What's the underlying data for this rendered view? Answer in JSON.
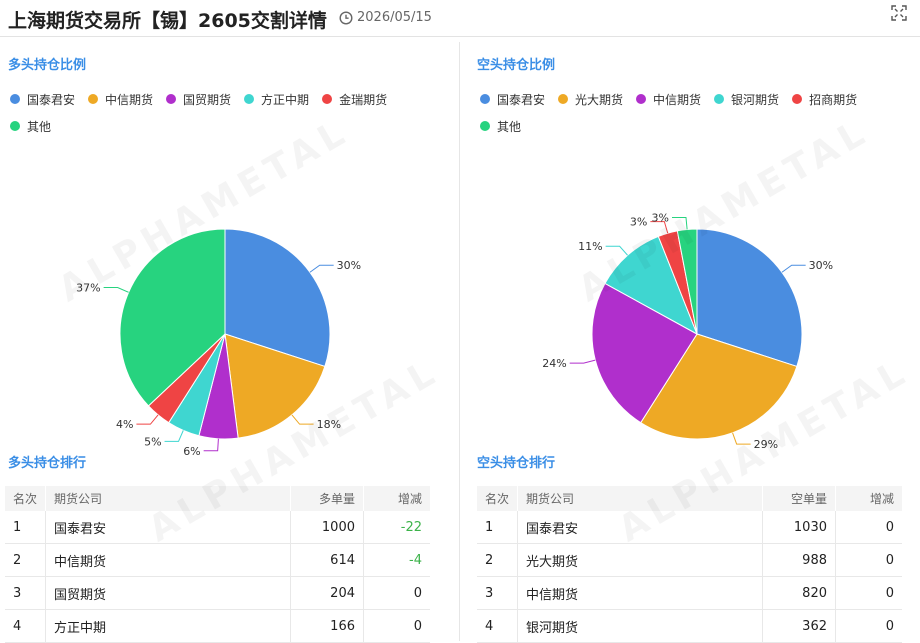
{
  "header": {
    "title": "上海期货交易所【锡】2605交割详情",
    "date": "2026/05/15"
  },
  "watermark": "ALPHAMETAL",
  "long_section": {
    "pie_title": "多头持仓比例",
    "table_title": "多头持仓排行",
    "columns": [
      "名次",
      "期货公司",
      "多单量",
      "增减"
    ],
    "rows": [
      {
        "rank": "1",
        "company": "国泰君安",
        "volume": "1000",
        "change": "-22"
      },
      {
        "rank": "2",
        "company": "中信期货",
        "volume": "614",
        "change": "-4"
      },
      {
        "rank": "3",
        "company": "国贸期货",
        "volume": "204",
        "change": "0"
      },
      {
        "rank": "4",
        "company": "方正中期",
        "volume": "166",
        "change": "0"
      }
    ]
  },
  "short_section": {
    "pie_title": "空头持仓比例",
    "table_title": "空头持仓排行",
    "columns": [
      "名次",
      "期货公司",
      "空单量",
      "增减"
    ],
    "rows": [
      {
        "rank": "1",
        "company": "国泰君安",
        "volume": "1030",
        "change": "0"
      },
      {
        "rank": "2",
        "company": "光大期货",
        "volume": "988",
        "change": "0"
      },
      {
        "rank": "3",
        "company": "中信期货",
        "volume": "820",
        "change": "0"
      },
      {
        "rank": "4",
        "company": "银河期货",
        "volume": "362",
        "change": "0"
      }
    ]
  },
  "chart_data": [
    {
      "type": "pie",
      "title": "多头持仓比例",
      "categories": [
        "国泰君安",
        "中信期货",
        "国贸期货",
        "方正中期",
        "金瑞期货",
        "其他"
      ],
      "values": [
        30,
        18,
        6,
        5,
        4,
        37
      ],
      "labels": [
        "30%",
        "18%",
        "6%",
        "5%",
        "4%",
        "37%"
      ],
      "colors": [
        "#4a8de0",
        "#eea925",
        "#b02fcc",
        "#3fd6d0",
        "#ef4444",
        "#27d37f"
      ],
      "legend": "top"
    },
    {
      "type": "pie",
      "title": "空头持仓比例",
      "categories": [
        "国泰君安",
        "光大期货",
        "中信期货",
        "银河期货",
        "招商期货",
        "其他"
      ],
      "values": [
        30,
        29,
        24,
        11,
        3,
        3
      ],
      "labels": [
        "30%",
        "29%",
        "24%",
        "11%",
        "3%",
        "3%"
      ],
      "colors": [
        "#4a8de0",
        "#eea925",
        "#b02fcc",
        "#3fd6d0",
        "#ef4444",
        "#27d37f"
      ],
      "legend": "top"
    }
  ]
}
